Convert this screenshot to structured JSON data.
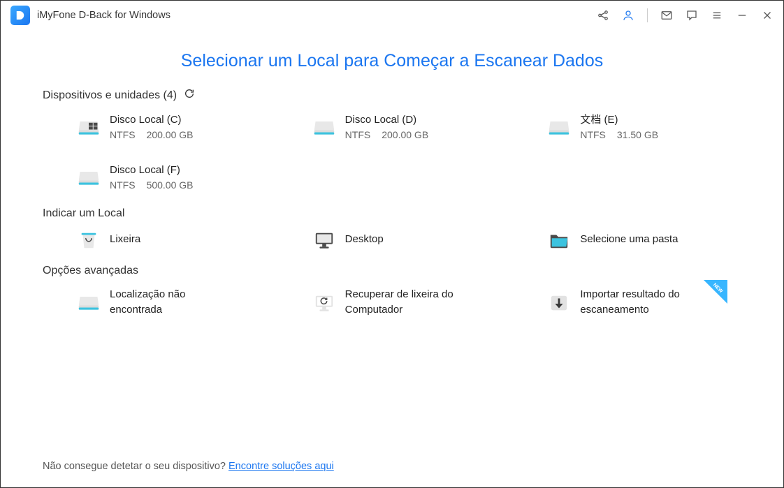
{
  "app_title": "iMyFone D-Back for Windows",
  "page_title": "Selecionar um Local para Começar a Escanear Dados",
  "sections": {
    "devices_header": "Dispositivos e unidades (4)",
    "location_header": "Indicar um Local",
    "advanced_header": "Opções avançadas"
  },
  "drives": [
    {
      "title": "Disco Local (C)",
      "fs": "NTFS",
      "size": "200.00 GB"
    },
    {
      "title": "Disco Local (D)",
      "fs": "NTFS",
      "size": "200.00 GB"
    },
    {
      "title": "文档 (E)",
      "fs": "NTFS",
      "size": "31.50 GB"
    },
    {
      "title": "Disco Local (F)",
      "fs": "NTFS",
      "size": "500.00 GB"
    }
  ],
  "locations": {
    "recycle": "Lixeira",
    "desktop": "Desktop",
    "folder": "Selecione uma pasta"
  },
  "advanced": {
    "lost": "Localização não encontrada",
    "recover": "Recuperar de lixeira do Computador",
    "import": "Importar resultado do escaneamento",
    "new_badge": "NEW"
  },
  "footer": {
    "text": "Não consegue detetar o seu dispositivo? ",
    "link": "Encontre soluções aqui"
  }
}
